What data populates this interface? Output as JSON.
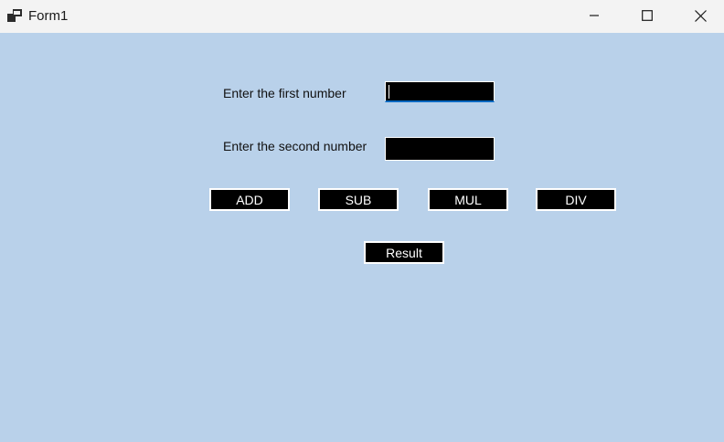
{
  "window": {
    "title": "Form1",
    "app_icon": "winforms-app-icon",
    "controls": {
      "minimize_icon": "minimize-icon",
      "maximize_icon": "maximize-icon",
      "close_icon": "close-icon"
    }
  },
  "form": {
    "first_label": "Enter the first number",
    "second_label": "Enter the second number",
    "first_value": "",
    "second_value": "",
    "buttons": {
      "add": "ADD",
      "sub": "SUB",
      "mul": "MUL",
      "div": "DIV",
      "result": "Result"
    }
  },
  "colors": {
    "background": "#b9d1ea",
    "titlebar": "#f3f3f3",
    "control_fill": "#000000",
    "control_text": "#ffffff",
    "focus_accent": "#0067c0"
  }
}
